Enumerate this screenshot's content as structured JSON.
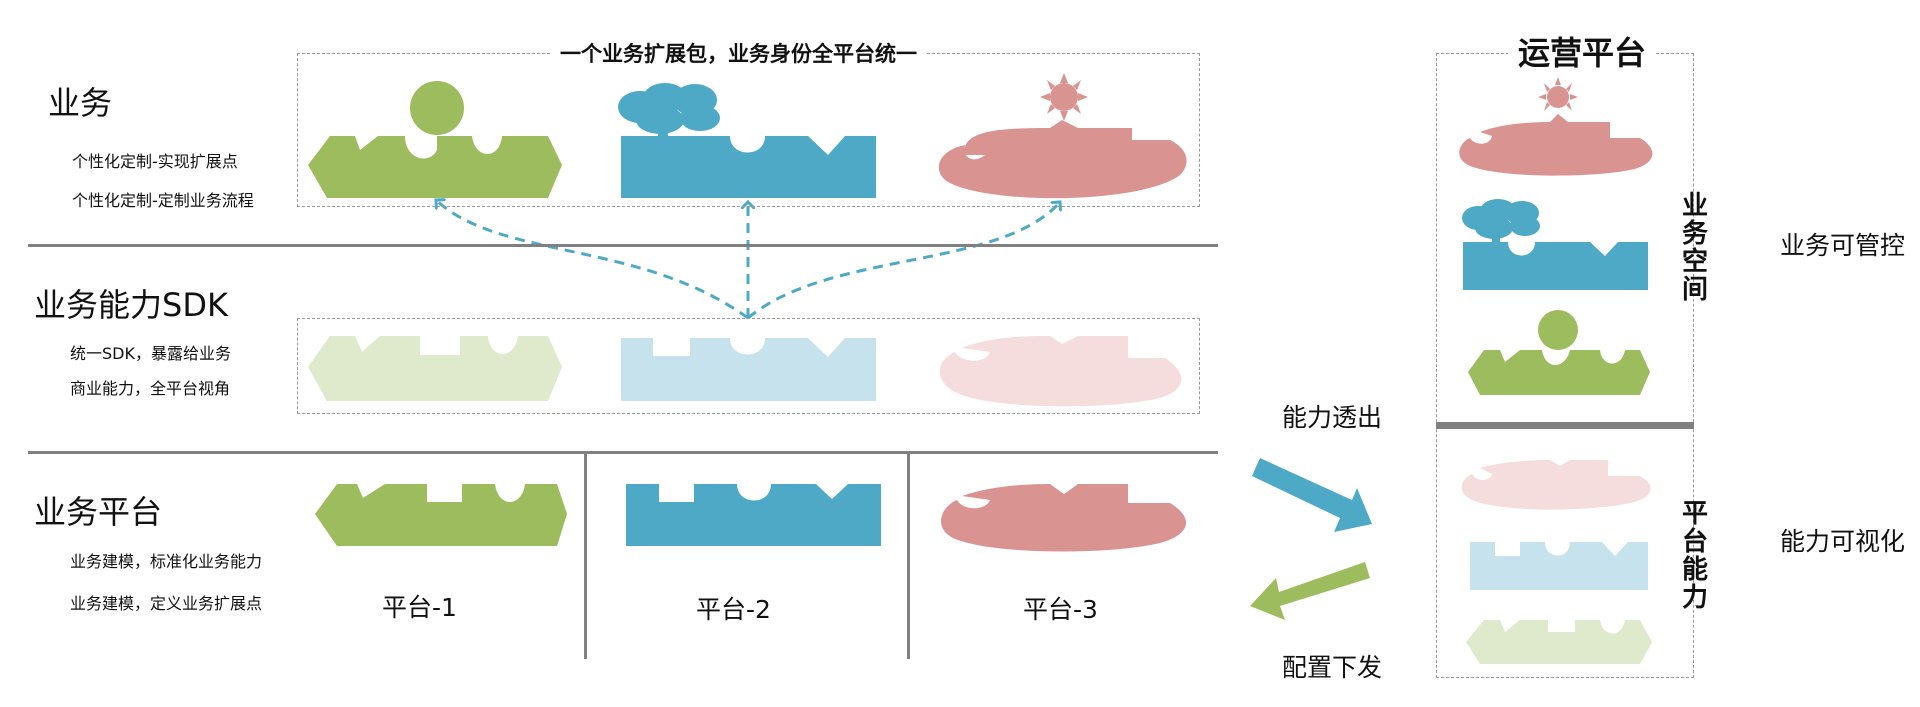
{
  "layers": {
    "business": {
      "title": "业务",
      "desc": [
        "个性化定制-实现扩展点",
        "个性化定制-定制业务流程"
      ],
      "box_title": "一个业务扩展包，业务身份全平台统一"
    },
    "sdk": {
      "title": "业务能力SDK",
      "desc": [
        "统一SDK，暴露给业务",
        "商业能力，全平台视角"
      ]
    },
    "platform": {
      "title": "业务平台",
      "desc": [
        "业务建模，标准化业务能力",
        "业务建模，定义业务扩展点"
      ],
      "columns": [
        "平台-1",
        "平台-2",
        "平台-3"
      ]
    }
  },
  "flow": {
    "out_label": "能力透出",
    "in_label": "配置下发"
  },
  "ops": {
    "title": "运营平台",
    "business_space_label": "业务空间",
    "platform_capability_label": "平台能力"
  },
  "right": {
    "controllable": "业务可管控",
    "visualized": "能力可视化"
  },
  "colors": {
    "green": "#9cbc5e",
    "blue": "#4ea9c6",
    "pink": "#d99492",
    "green_light": "#dfe9cb",
    "blue_light": "#c6e3ed",
    "pink_light": "#f5dcdd",
    "divider": "#808080",
    "dashed_arrow": "#4ea9c6"
  }
}
